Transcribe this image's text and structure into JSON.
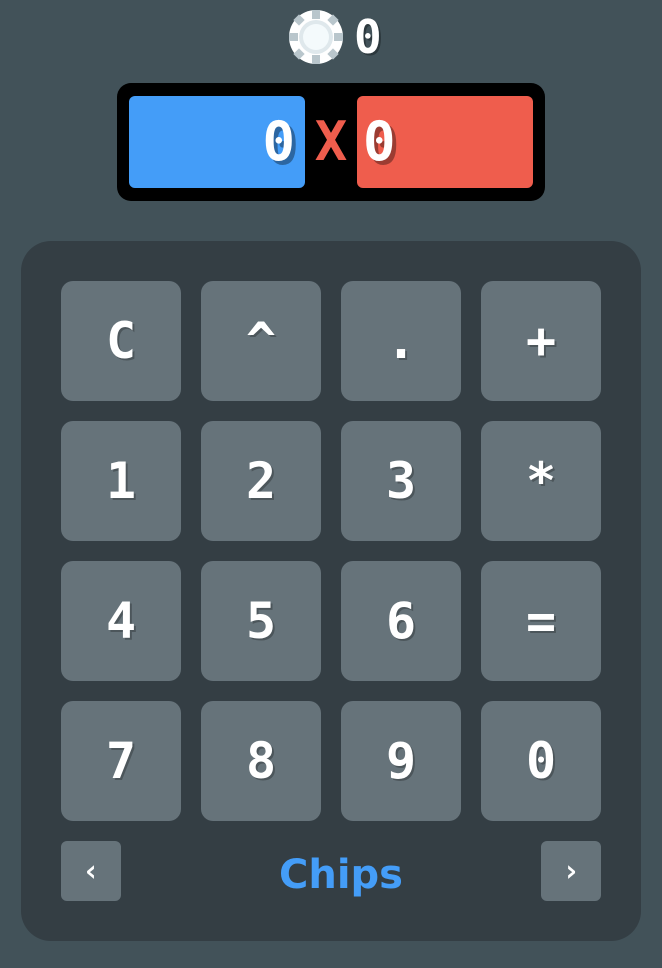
{
  "chip_counter": {
    "icon": "poker-chip-icon",
    "count": "0"
  },
  "score": {
    "blue": "0",
    "separator": "X",
    "red": "0",
    "colors": {
      "blue": "#449df8",
      "red": "#ef5d4d"
    }
  },
  "keypad": {
    "rows": [
      [
        "C",
        "^",
        ".",
        "+"
      ],
      [
        "1",
        "2",
        "3",
        "*"
      ],
      [
        "4",
        "5",
        "6",
        "="
      ],
      [
        "7",
        "8",
        "9",
        "0"
      ]
    ]
  },
  "mode": {
    "prev_icon": "chevron-left-icon",
    "prev_label": "‹",
    "label": "Chips",
    "next_icon": "chevron-right-icon",
    "next_label": "›"
  }
}
